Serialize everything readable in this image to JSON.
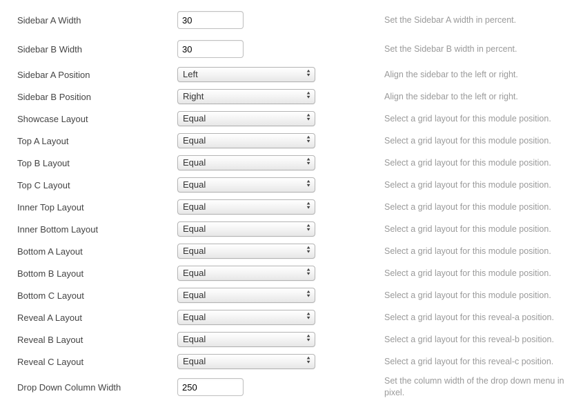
{
  "rows": [
    {
      "id": "sidebar-a-width",
      "label": "Sidebar A Width",
      "type": "text",
      "value": "30",
      "help": "Set the Sidebar A width in percent."
    },
    {
      "id": "sidebar-b-width",
      "label": "Sidebar B Width",
      "type": "text",
      "value": "30",
      "help": "Set the Sidebar B width in percent."
    },
    {
      "id": "sidebar-a-position",
      "label": "Sidebar A Position",
      "type": "select",
      "value": "Left",
      "help": "Align the sidebar to the left or right."
    },
    {
      "id": "sidebar-b-position",
      "label": "Sidebar B Position",
      "type": "select",
      "value": "Right",
      "help": "Align the sidebar to the left or right."
    },
    {
      "id": "showcase-layout",
      "label": "Showcase Layout",
      "type": "select",
      "value": "Equal",
      "help": "Select a grid layout for this module position."
    },
    {
      "id": "top-a-layout",
      "label": "Top A Layout",
      "type": "select",
      "value": "Equal",
      "help": "Select a grid layout for this module position."
    },
    {
      "id": "top-b-layout",
      "label": "Top B Layout",
      "type": "select",
      "value": "Equal",
      "help": "Select a grid layout for this module position."
    },
    {
      "id": "top-c-layout",
      "label": "Top C Layout",
      "type": "select",
      "value": "Equal",
      "help": "Select a grid layout for this module position."
    },
    {
      "id": "inner-top-layout",
      "label": "Inner Top Layout",
      "type": "select",
      "value": "Equal",
      "help": "Select a grid layout for this module position."
    },
    {
      "id": "inner-bottom-layout",
      "label": "Inner Bottom Layout",
      "type": "select",
      "value": "Equal",
      "help": "Select a grid layout for this module position."
    },
    {
      "id": "bottom-a-layout",
      "label": "Bottom A Layout",
      "type": "select",
      "value": "Equal",
      "help": "Select a grid layout for this module position."
    },
    {
      "id": "bottom-b-layout",
      "label": "Bottom B Layout",
      "type": "select",
      "value": "Equal",
      "help": "Select a grid layout for this module position."
    },
    {
      "id": "bottom-c-layout",
      "label": "Bottom C Layout",
      "type": "select",
      "value": "Equal",
      "help": "Select a grid layout for this module position."
    },
    {
      "id": "reveal-a-layout",
      "label": "Reveal A Layout",
      "type": "select",
      "value": "Equal",
      "help": "Select a grid layout for this reveal-a position."
    },
    {
      "id": "reveal-b-layout",
      "label": "Reveal B Layout",
      "type": "select",
      "value": "Equal",
      "help": "Select a grid layout for this reveal-b position."
    },
    {
      "id": "reveal-c-layout",
      "label": "Reveal C Layout",
      "type": "select",
      "value": "Equal",
      "help": "Select a grid layout for this reveal-c position."
    },
    {
      "id": "dropdown-column-width",
      "label": "Drop Down Column Width",
      "type": "text",
      "value": "250",
      "help": "Set the column width of the drop down menu in pixel."
    }
  ]
}
